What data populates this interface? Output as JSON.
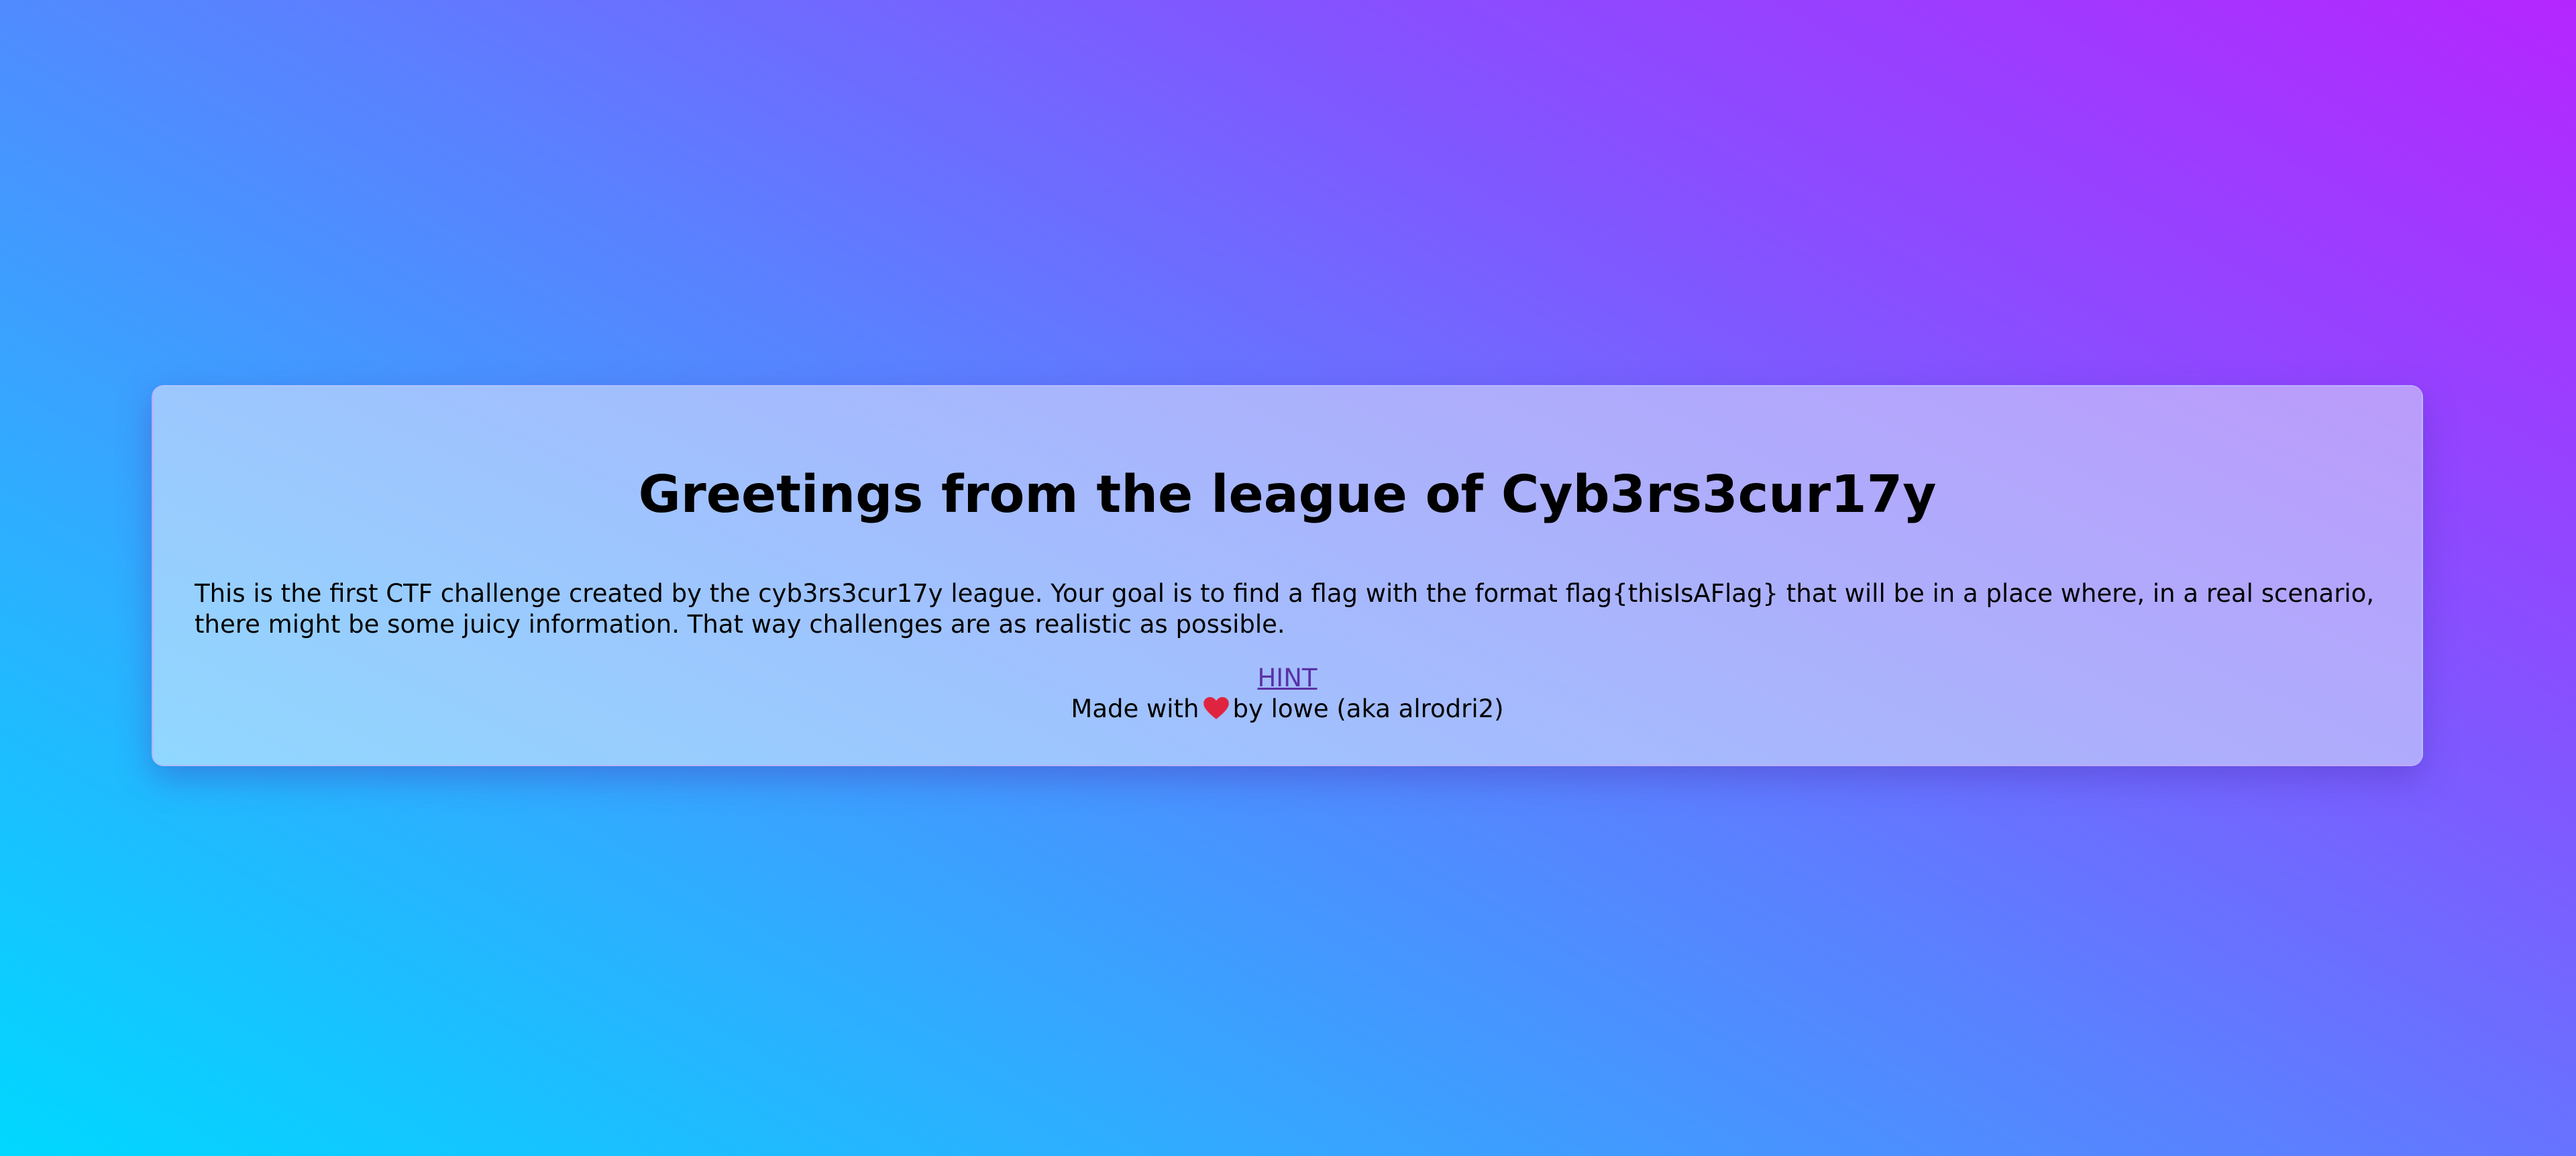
{
  "page": {
    "title": "Greetings from the league of Cyb3rs3cur17y",
    "description": "This is the first CTF challenge created by the cyb3rs3cur17y league. Your goal is to find a flag with the format flag{thisIsAFlag} that will be in a place where, in a real scenario, there might be some juicy information. That way challenges are as realistic as possible.",
    "hint_label": "HINT",
    "credits_prefix": "Made with",
    "credits_suffix": "by lowe (aka alrodri2)",
    "heart_icon": "heart-icon",
    "heart_color": "#e0243f",
    "link_color": "#5a31a6"
  }
}
